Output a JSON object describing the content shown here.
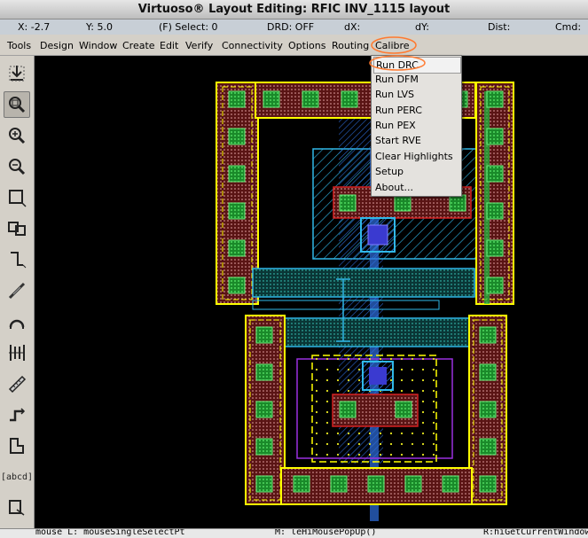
{
  "window": {
    "title": "Virtuoso® Layout Editing: RFIC INV_1115 layout"
  },
  "status": {
    "x": "X: -2.7",
    "y": "Y: 5.0",
    "select": "(F) Select: 0",
    "drd": "DRD: OFF",
    "dx": "dX:",
    "dy": "dY:",
    "dist": "Dist:",
    "cmd": "Cmd:"
  },
  "menu": [
    "Tools",
    "Design",
    "Window",
    "Create",
    "Edit",
    "Verify",
    "Connectivity",
    "Options",
    "Routing",
    "Calibre"
  ],
  "calibre_menu": [
    "Run DRC",
    "Run DFM",
    "Run LVS",
    "Run PERC",
    "Run PEX",
    "Start RVE",
    "Clear Highlights",
    "Setup",
    "About..."
  ],
  "toolbar": {
    "icons": [
      "save-icon",
      "fit-view-icon",
      "zoom-in-icon",
      "zoom-out-icon",
      "rectangle-icon",
      "instance-icon",
      "path-icon",
      "wire-icon",
      "arc-icon",
      "align-icon",
      "ruler-icon",
      "stretch-icon",
      "polygon-icon",
      "label-icon",
      "select-icon"
    ],
    "label_text": "[abcd]"
  },
  "bottom": {
    "left": "mouse L: mouseSingleSelectPt",
    "middle": "M: leHiMousePopUp()",
    "right": "R:hiGetCurrentWindow"
  },
  "colors": {
    "metal1": "#2f6fe0",
    "poly": "#d42020",
    "nwell": "#30b8e8",
    "via": "#20c040",
    "boundary": "#ffff00",
    "implant": "#9a30e0",
    "annotation": "#ff7a30"
  }
}
